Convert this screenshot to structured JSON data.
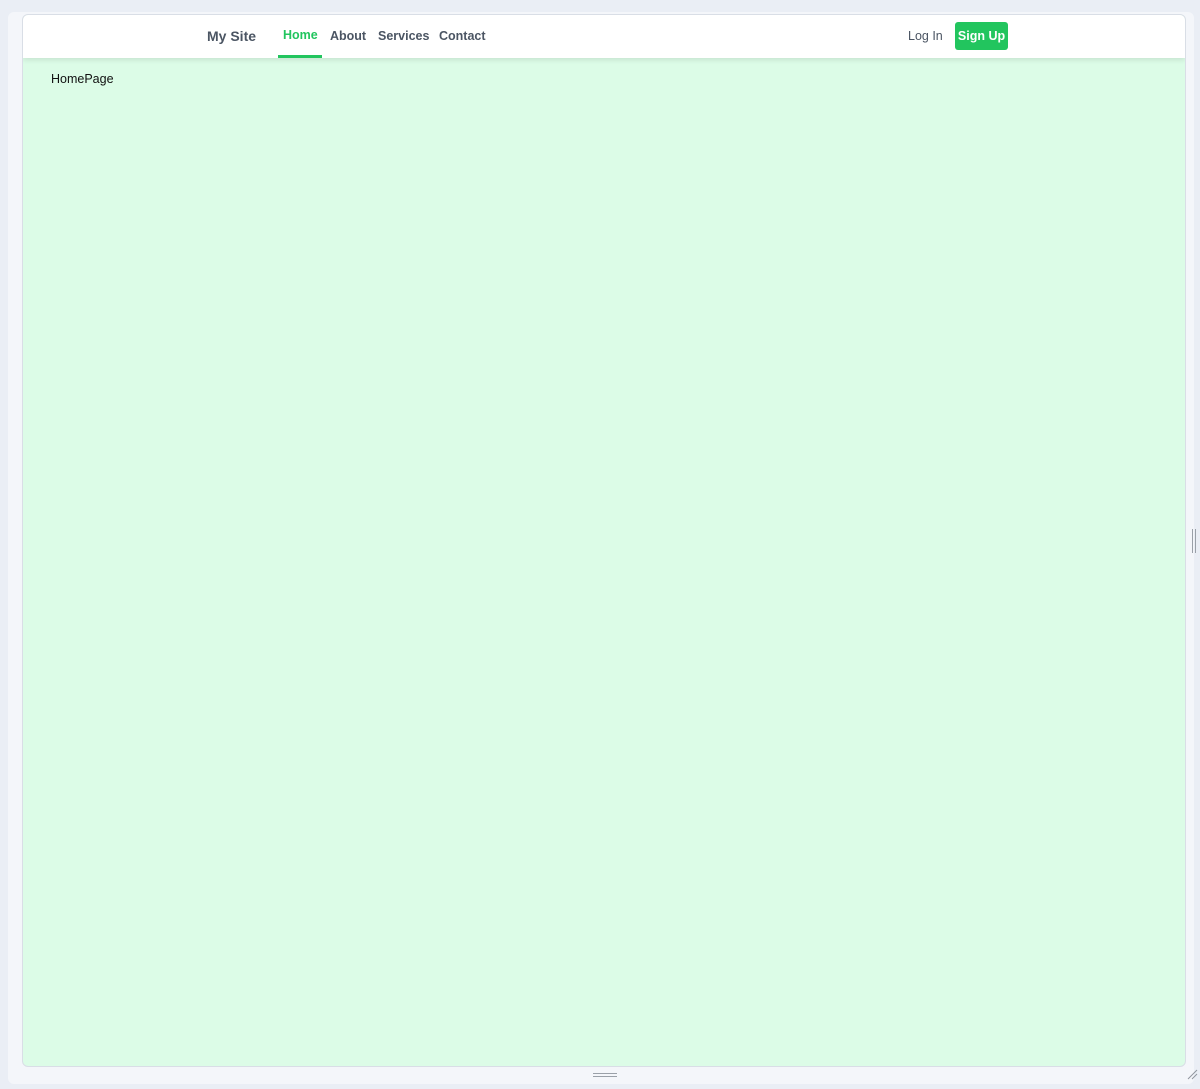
{
  "navbar": {
    "brand": "My Site",
    "links": [
      {
        "label": "Home",
        "active": true
      },
      {
        "label": "About",
        "active": false
      },
      {
        "label": "Services",
        "active": false
      },
      {
        "label": "Contact",
        "active": false
      }
    ],
    "login_label": "Log In",
    "signup_label": "Sign Up"
  },
  "main": {
    "text": "HomePage"
  },
  "colors": {
    "accent": "#22c55e",
    "page_background": "#dcfce7",
    "nav_text": "#4b5563"
  },
  "icons": {
    "bottom_handle": "drag-handle-horizontal-icon",
    "side_handle": "drag-handle-vertical-icon",
    "corner": "resize-corner-icon"
  }
}
